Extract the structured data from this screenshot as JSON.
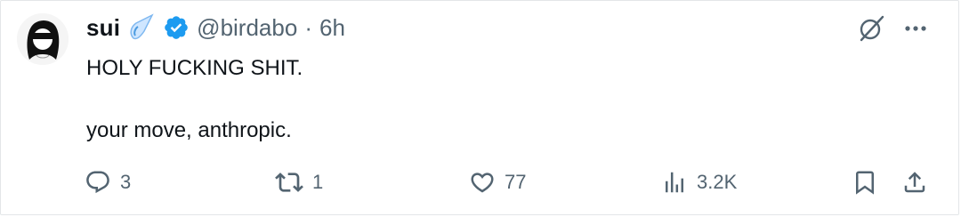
{
  "tweet": {
    "display_name": "sui",
    "handle": "@birdabo",
    "separator": "·",
    "time": "6h",
    "text_line_1": "HOLY FUCKING SHIT.",
    "text_line_2": "your move, anthropic."
  },
  "actions": {
    "reply_count": "3",
    "retweet_count": "1",
    "like_count": "77",
    "views_count": "3.2K"
  },
  "icons": {
    "avatar": "avatar",
    "emoji": "meteor-icon",
    "verified": "verified-badge-icon",
    "grok": "grok-icon",
    "more": "more-icon",
    "reply": "reply-icon",
    "retweet": "retweet-icon",
    "like": "heart-icon",
    "views": "views-icon",
    "bookmark": "bookmark-icon",
    "share": "share-icon"
  },
  "colors": {
    "text": "#0f1419",
    "secondary": "#536471",
    "verified_blue": "#1d9bf0",
    "border": "#e3e6e8"
  }
}
